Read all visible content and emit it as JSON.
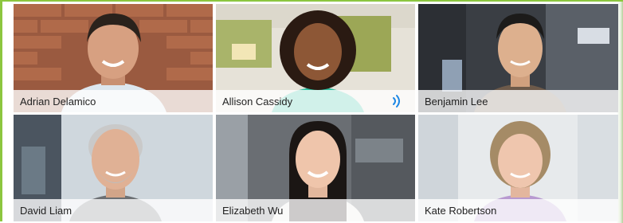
{
  "participants": [
    {
      "name": "Adrian Delamico",
      "speaking": false
    },
    {
      "name": "Allison Cassidy",
      "speaking": true
    },
    {
      "name": "Benjamin Lee",
      "speaking": false
    },
    {
      "name": "David Liam",
      "speaking": false
    },
    {
      "name": "Elizabeth Wu",
      "speaking": false
    },
    {
      "name": "Kate Robertson",
      "speaking": false
    }
  ],
  "colors": {
    "border": "#8cc63f",
    "speaking_indicator": "#1e88e5"
  },
  "icons": {
    "speaking": "speaking-icon"
  }
}
